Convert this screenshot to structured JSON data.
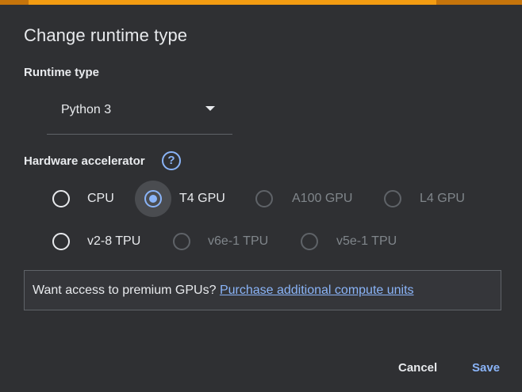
{
  "dialog": {
    "title": "Change runtime type",
    "accent_colors": [
      "#c5740b",
      "#f39c12"
    ]
  },
  "runtime": {
    "label": "Runtime type",
    "selected": "Python 3"
  },
  "hardware": {
    "label": "Hardware accelerator",
    "help_icon": "?",
    "options": [
      {
        "label": "CPU",
        "checked": false,
        "disabled": false
      },
      {
        "label": "T4 GPU",
        "checked": true,
        "disabled": false
      },
      {
        "label": "A100 GPU",
        "checked": false,
        "disabled": true
      },
      {
        "label": "L4 GPU",
        "checked": false,
        "disabled": true
      },
      {
        "label": "v2-8 TPU",
        "checked": false,
        "disabled": false
      },
      {
        "label": "v6e-1 TPU",
        "checked": false,
        "disabled": true
      },
      {
        "label": "v5e-1 TPU",
        "checked": false,
        "disabled": true
      }
    ]
  },
  "promo": {
    "text": "Want access to premium GPUs?",
    "link": "Purchase additional compute units"
  },
  "actions": {
    "cancel": "Cancel",
    "save": "Save"
  },
  "colors": {
    "accent_blue": "#8ab4f8",
    "background": "#2f3033"
  }
}
